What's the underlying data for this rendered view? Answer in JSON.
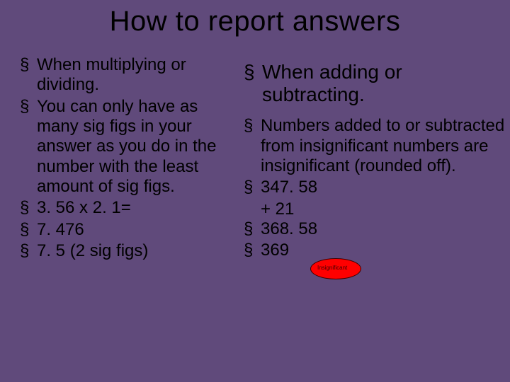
{
  "title": "How to report answers",
  "left": {
    "items": [
      "When multiplying or dividing.",
      "You can only have as many sig figs in your answer as you do in the number with the least amount of sig figs.",
      "3. 56 x 2. 1=",
      "7. 476",
      "7. 5 (2 sig figs)"
    ]
  },
  "right": {
    "lead": "When adding or subtracting.",
    "items": [
      "Numbers added to or subtracted from insignificant numbers are insignificant (rounded off).",
      " 347. 58",
      "368. 58",
      "369"
    ],
    "plus_line": "+ 21"
  },
  "ellipse_label": "Insignificant"
}
